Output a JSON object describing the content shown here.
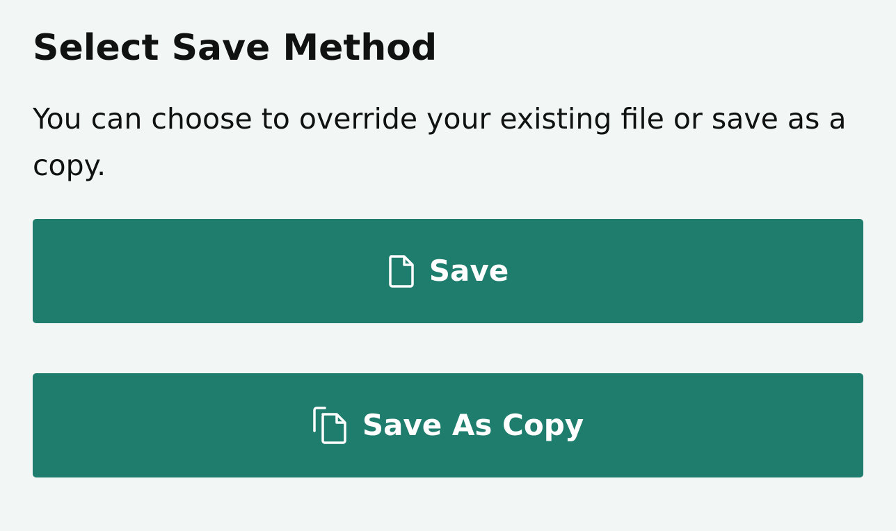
{
  "dialog": {
    "title": "Select Save Method",
    "description": "You can choose to override your existing file or save as a copy."
  },
  "buttons": {
    "save": {
      "label": "Save",
      "icon": "file-icon"
    },
    "save_as_copy": {
      "label": "Save As Copy",
      "icon": "copy-icon"
    }
  },
  "colors": {
    "background": "#f2f7f5",
    "button": "#1f7d6d",
    "button_text": "#ffffff",
    "text": "#0f1211"
  }
}
